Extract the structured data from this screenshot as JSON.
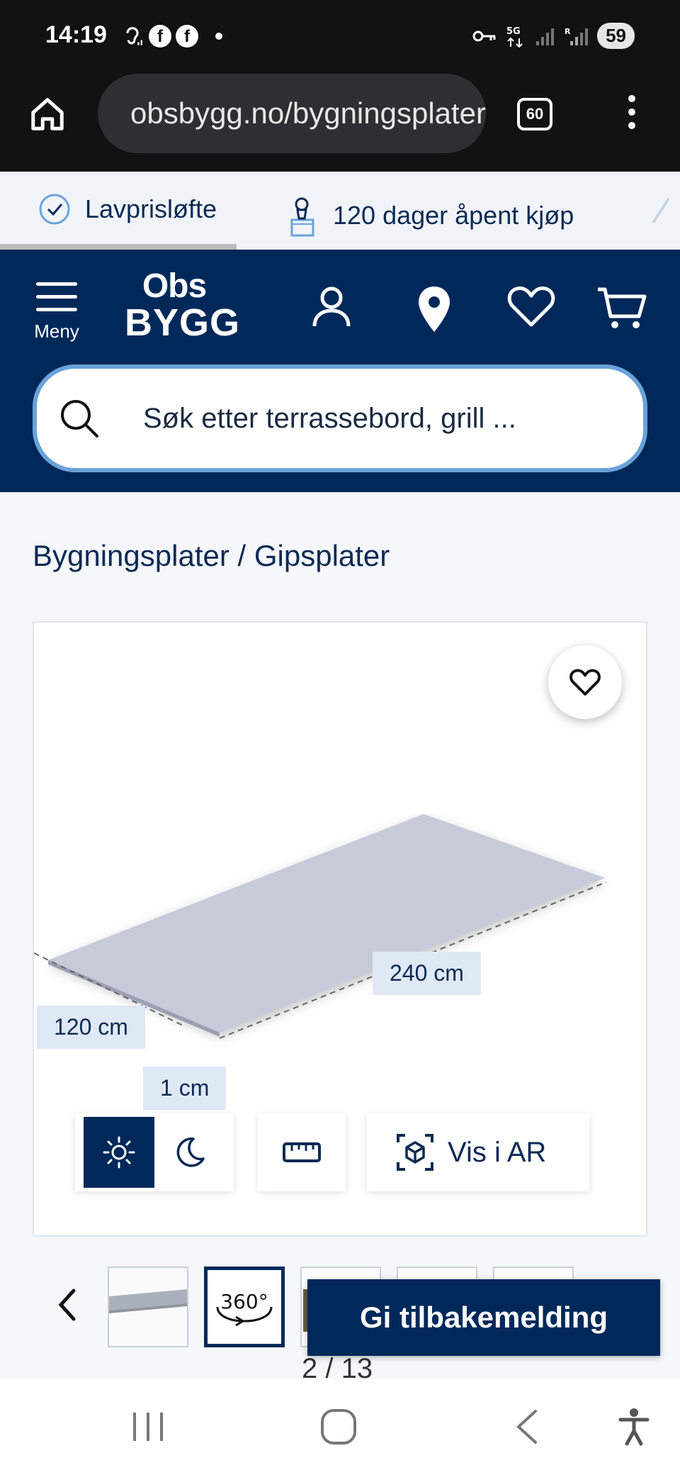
{
  "status_bar": {
    "time": "14:19",
    "notif_icons": [
      "ear-icon",
      "facebook-icon",
      "facebook-icon"
    ],
    "battery": "59",
    "network": "5G",
    "roaming": "R"
  },
  "browser": {
    "url": "obsbygg.no/bygningsplater/gipsplater",
    "tab_count": "60"
  },
  "usp": {
    "items": [
      {
        "label": "Lavprisløfte",
        "icon": "check-badge-icon"
      },
      {
        "label": "120 dager åpent kjøp",
        "icon": "package-icon"
      }
    ]
  },
  "header": {
    "menu_label": "Meny",
    "logo_top": "Obs",
    "logo_bottom": "BYGG",
    "icons": [
      "user-icon",
      "location-pin-icon",
      "heart-icon",
      "cart-icon"
    ]
  },
  "search": {
    "placeholder": "Søk etter terrassebord, grill ..."
  },
  "breadcrumb": {
    "text": "Bygningsplater / Gipsplater"
  },
  "product_image": {
    "dimensions": {
      "length": "240 cm",
      "width": "120 cm",
      "thickness": "1 cm"
    },
    "ar_label": "Vis i AR"
  },
  "gallery": {
    "counter": "2 / 13",
    "selected_index": 2,
    "thumb_360_label": "360°"
  },
  "feedback": {
    "label": "Gi tilbakemelding"
  },
  "colors": {
    "brand_navy": "#00295a",
    "search_border": "#6aa3d8",
    "label_bg": "#dfe8f5"
  }
}
